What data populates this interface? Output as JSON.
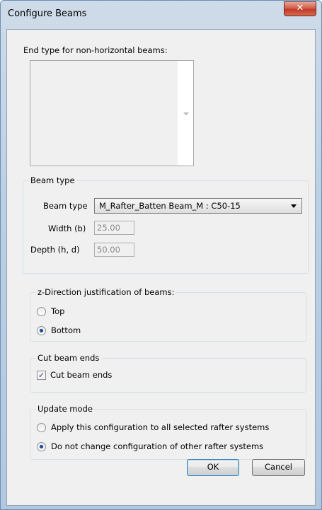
{
  "window": {
    "title": "Configure Beams",
    "close_glyph": "✕"
  },
  "end_type": {
    "label": "End type for non-horizontal beams:"
  },
  "beam_type_group": {
    "title": "Beam type",
    "beam_type_label": "Beam type",
    "beam_type_value": "M_Rafter_Batten Beam_M : C50-15",
    "width_label": "Width (b)",
    "width_value": "25.00",
    "depth_label": "Depth (h, d)",
    "depth_value": "50.00"
  },
  "z_group": {
    "title": "z-Direction justification of beams:",
    "options": [
      {
        "label": "Top",
        "selected": false
      },
      {
        "label": "Bottom",
        "selected": true
      }
    ]
  },
  "cut_group": {
    "title": "Cut beam ends",
    "checkbox_label": "Cut beam ends",
    "checked": true,
    "check_glyph": "✓"
  },
  "update_group": {
    "title": "Update mode",
    "options": [
      {
        "label": "Apply this configuration to all selected rafter systems",
        "selected": false
      },
      {
        "label": "Do not change configuration of other rafter systems",
        "selected": true
      }
    ]
  },
  "buttons": {
    "ok": "OK",
    "cancel": "Cancel"
  }
}
